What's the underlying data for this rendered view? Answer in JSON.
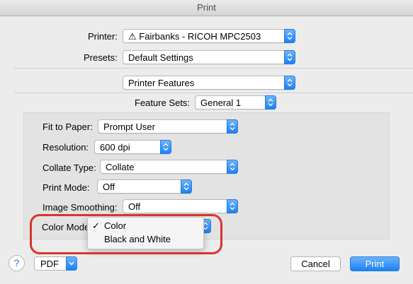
{
  "window": {
    "title": "Print"
  },
  "printer": {
    "label": "Printer:",
    "warning_glyph": "⚠",
    "value": "Fairbanks - RICOH MPC2503"
  },
  "presets": {
    "label": "Presets:",
    "value": "Default Settings"
  },
  "section": {
    "value": "Printer Features"
  },
  "feature_sets": {
    "label": "Feature Sets:",
    "value": "General 1"
  },
  "options": {
    "fit_to_paper": {
      "label": "Fit to Paper:",
      "value": "Prompt User"
    },
    "resolution": {
      "label": "Resolution:",
      "value": "600 dpi"
    },
    "collate_type": {
      "label": "Collate Type:",
      "value": "Collate"
    },
    "print_mode": {
      "label": "Print Mode:",
      "value": "Off"
    },
    "image_smoothing": {
      "label": "Image Smoothing:",
      "value": "Off"
    },
    "color_mode": {
      "label": "Color Mode"
    }
  },
  "color_menu": {
    "items": [
      {
        "label": "Color",
        "check": "✓",
        "selected": true
      },
      {
        "label": "Black and White",
        "check": "",
        "selected": false
      }
    ]
  },
  "highlight_color": "#d9352c",
  "accent_color": "#1a82f6",
  "footer": {
    "help": "?",
    "pdf": "PDF",
    "cancel": "Cancel",
    "print": "Print"
  }
}
